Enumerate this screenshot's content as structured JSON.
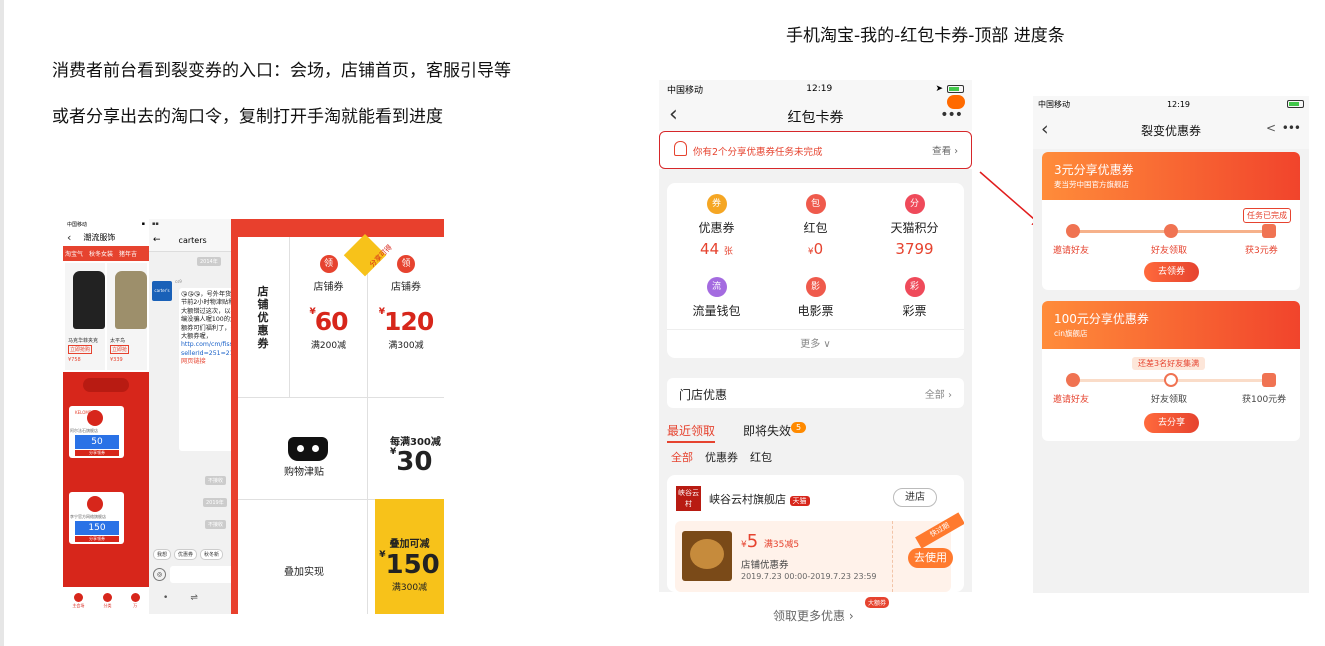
{
  "intro": {
    "line1": "消费者前台看到裂变券的入口：会场，店铺首页，客服引导等",
    "line2": "或者分享出去的淘口令，复制打开手淘就能看到进度"
  },
  "slide_title": "手机淘宝-我的-红包卡券-顶部 进度条",
  "collage": {
    "shot1": {
      "status_left": "中国移动",
      "nav_title": "潮流服饰",
      "tabs": [
        "淘宝气",
        "秋冬女装",
        "猪年吉"
      ],
      "products": [
        {
          "name": "马克华菲夹克",
          "tag": "立即抢购",
          "price": "¥758"
        },
        {
          "name": "太平鸟",
          "tag": "立即抢",
          "price": "¥339"
        }
      ],
      "cards": [
        {
          "label": "KELOME",
          "shop": "阿尔法石旗舰店",
          "amount": "50",
          "cond": "满300使用",
          "btn": "分享领券"
        },
        {
          "label": "",
          "shop": "李宁官方网络旗舰店",
          "amount": "150",
          "cond": "满300使用",
          "btn": "分享领券"
        }
      ],
      "bottom_nav": [
        "主会场",
        "分类",
        "万"
      ]
    },
    "shot2": {
      "nav_title": "carters",
      "timestamp_top": "2014年",
      "sender": "cs9",
      "avatar_text": "carter's",
      "message_text": "😘😘😘，号外年货节前2小时物津贴和大额错过这次，以小编没骗人喔100的大额券可们福利了，分大额券喔，",
      "link_text": "http.com/cm/fiss?sellerId=251=2143ad5637l0f784f8c6b3e6f230f3386407e29399f03231couponType=",
      "link_footer": "网页链接",
      "timestamps": [
        "不接收",
        "2019年",
        "不接收"
      ],
      "quick_replies": [
        "我想",
        "优惠券",
        "秋冬新"
      ]
    },
    "shot3": {
      "vertical_title": "店铺优惠券",
      "ling": "领",
      "coupon_label": "店铺券",
      "coupon1": {
        "amount": "60",
        "cond": "满200减"
      },
      "coupon2": {
        "amount": "120",
        "cond": "满300减"
      },
      "corner_tag": "分享可得",
      "tmall_label": "购物津贴",
      "mei_title": "每满300减",
      "mei_amount": "30",
      "stack_label": "叠加实现",
      "yellow_title": "叠加可减",
      "yellow_amount": "150",
      "yellow_cond": "满300减",
      "currency": "¥"
    }
  },
  "phone1": {
    "status_carrier": "中国移动",
    "status_time": "12:19",
    "nav_title": "红包卡券",
    "nav_more": "•••",
    "notice_text": "你有2个分享优惠券任务未完成",
    "notice_action": "查看 ›",
    "assets": [
      {
        "label": "优惠券",
        "value": "44",
        "unit": "张",
        "color": "#f5a623",
        "icon": "ticket-icon",
        "glyph": "券"
      },
      {
        "label": "红包",
        "value": "0",
        "unit": "¥",
        "color": "#ef5a4c",
        "icon": "red-packet-icon",
        "glyph": "包"
      },
      {
        "label": "天猫积分",
        "value": "3799",
        "unit": "",
        "color": "#ef4a5a",
        "icon": "tmall-points-icon",
        "glyph": "分"
      },
      {
        "label": "流量钱包",
        "color": "#a46be0",
        "icon": "data-wallet-icon",
        "glyph": "流"
      },
      {
        "label": "电影票",
        "color": "#ef5a4c",
        "icon": "movie-ticket-icon",
        "glyph": "影"
      },
      {
        "label": "彩票",
        "color": "#ef4a5a",
        "icon": "lottery-icon",
        "glyph": "彩"
      }
    ],
    "more_text": "更多 ∨",
    "shop_coupons_label": "门店优惠",
    "shop_coupons_all": "全部 ›",
    "tabs": [
      "最近领取",
      "即将失效"
    ],
    "tab_badge": "5",
    "subtabs": [
      "全部",
      "优惠券",
      "红包"
    ],
    "store": {
      "logo_text": "峡谷云村",
      "name": "峡谷云村旗舰店",
      "badge": "天猫",
      "enter": "进店"
    },
    "coupon": {
      "amount": "5",
      "currency": "¥",
      "cond": "满35减5",
      "type": "店铺优惠券",
      "date": "2019.7.23 00:00-2019.7.23 23:59",
      "use_btn": "去使用",
      "expire_tag": "快过期"
    },
    "footer_text": "领取更多优惠 ›",
    "footer_badge": "大额券"
  },
  "phone2": {
    "status_carrier": "中国移动",
    "status_time": "12:19",
    "nav_title": "裂变优惠券",
    "nav_more": "•••",
    "card1": {
      "title": "3元分享优惠券",
      "shop": "麦当劳中国官方旗舰店",
      "status": "任务已完成",
      "steps": [
        "邀请好友",
        "好友领取",
        "获3元券"
      ],
      "button": "去领券"
    },
    "card2": {
      "title": "100元分享优惠券",
      "shop": "cin旗舰店",
      "hint": "还差3名好友集满",
      "steps": [
        "邀请好友",
        "好友领取",
        "获100元券"
      ],
      "button": "去分享"
    }
  }
}
